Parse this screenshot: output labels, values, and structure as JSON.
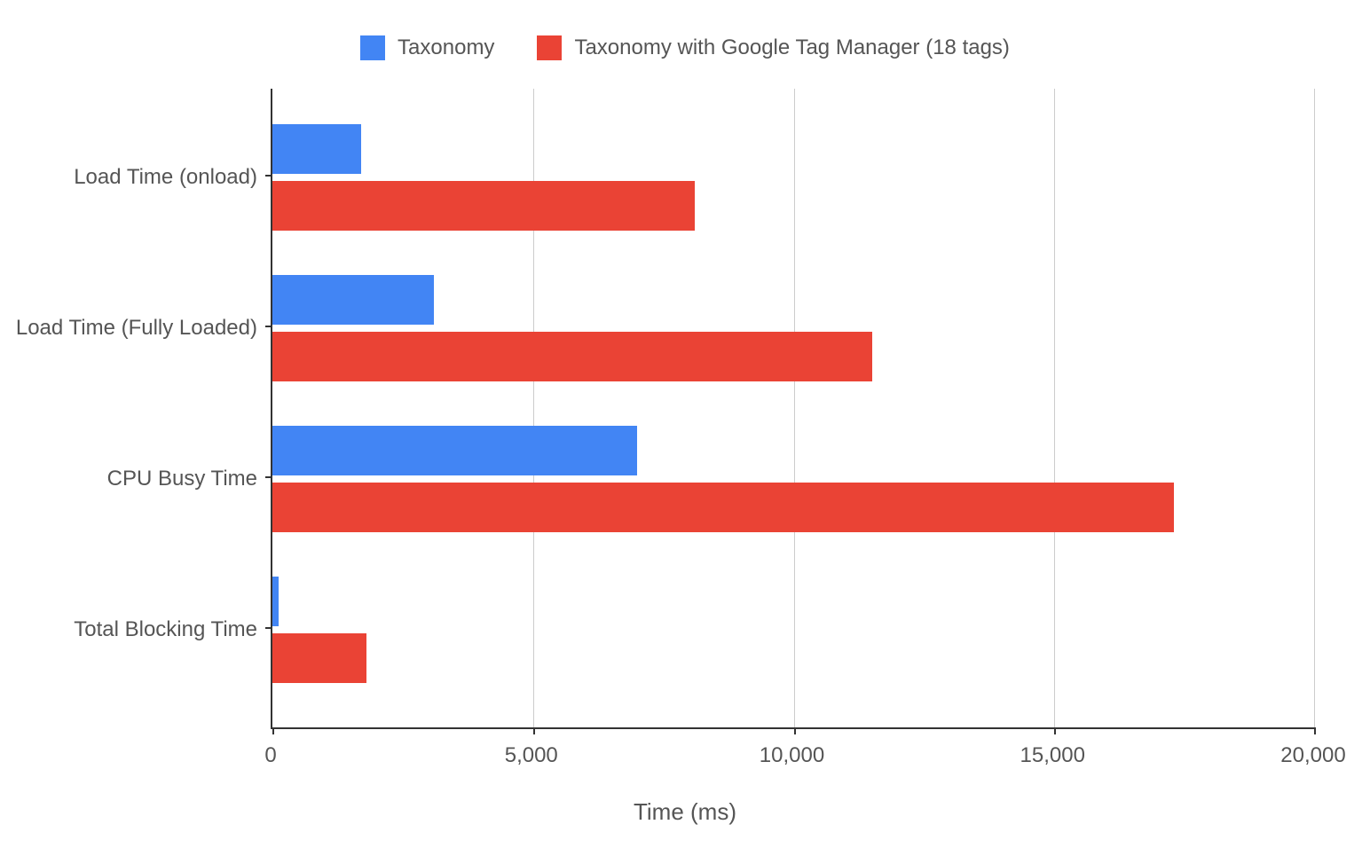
{
  "chart_data": {
    "type": "bar",
    "orientation": "horizontal",
    "categories": [
      "Load Time (onload)",
      "Load Time (Fully Loaded)",
      "CPU Busy Time",
      "Total Blocking Time"
    ],
    "series": [
      {
        "name": "Taxonomy",
        "color": "#4285f4",
        "values": [
          1700,
          3100,
          7000,
          120
        ]
      },
      {
        "name": "Taxonomy with Google Tag Manager (18 tags)",
        "color": "#ea4335",
        "values": [
          8100,
          11500,
          17300,
          1800
        ]
      }
    ],
    "xlabel": "Time (ms)",
    "ylabel": "",
    "xlim": [
      0,
      20000
    ],
    "x_ticks": [
      0,
      5000,
      10000,
      15000,
      20000
    ],
    "x_tick_labels": [
      "0",
      "5,000",
      "10,000",
      "15,000",
      "20,000"
    ],
    "title": ""
  }
}
